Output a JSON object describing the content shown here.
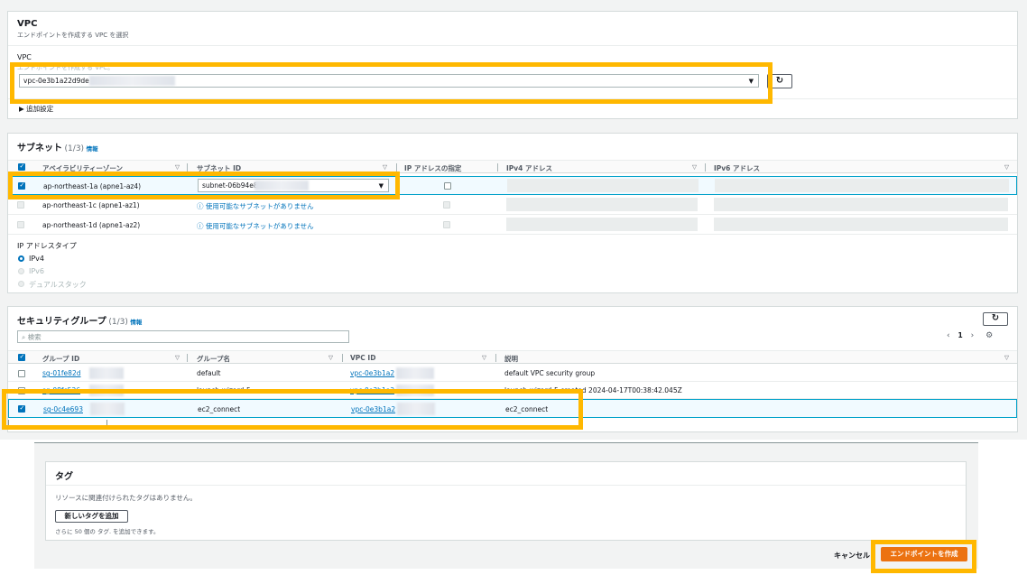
{
  "vpc_panel": {
    "title": "VPC",
    "subtitle": "エンドポイントを作成する VPC を選択",
    "field_label": "VPC",
    "field_hint": "エンドポイントを作成する VPC。",
    "selected_vpc": "vpc-0e3b1a22d9de",
    "advanced": "追加設定"
  },
  "subnet_panel": {
    "title": "サブネット",
    "count": "(1/3)",
    "info": "情報",
    "columns": [
      "アベイラビリティーゾーン",
      "サブネット ID",
      "IP アドレスの指定",
      "IPv4 アドレス",
      "IPv6 アドレス"
    ],
    "rows": [
      {
        "az": "ap-northeast-1a (apne1-az4)",
        "subnet": "subnet-06b94e8",
        "selected": true
      },
      {
        "az": "ap-northeast-1c (apne1-az1)",
        "subnet": "使用可能なサブネットがありません",
        "selected": false
      },
      {
        "az": "ap-northeast-1d (apne1-az2)",
        "subnet": "使用可能なサブネットがありません",
        "selected": false
      }
    ],
    "ip_type_label": "IP アドレスタイプ",
    "ip_types": [
      "IPv4",
      "IPv6",
      "デュアルスタック"
    ]
  },
  "sg_panel": {
    "title": "セキュリティグループ",
    "count": "(1/3)",
    "info": "情報",
    "search_placeholder": "検索",
    "page": "1",
    "columns": [
      "グループ ID",
      "グループ名",
      "VPC ID",
      "説明"
    ],
    "rows": [
      {
        "id": "sg-01fe82d",
        "name": "default",
        "vpc": "vpc-0e3b1a2",
        "desc": "default VPC security group",
        "selected": false
      },
      {
        "id": "sg-08fc526",
        "name": "launch-wizard-5",
        "vpc": "vpc-0e3b1a2",
        "desc": "launch-wizard-5 created 2024-04-17T00:38:42.045Z",
        "selected": false
      },
      {
        "id": "sg-0c4e693",
        "name": "ec2_connect",
        "vpc": "vpc-0e3b1a2",
        "desc": "ec2_connect",
        "selected": true
      }
    ]
  },
  "tags_panel": {
    "title": "タグ",
    "empty": "リソースに関連付けられたタグはありません。",
    "add_button": "新しいタグを追加",
    "limit": "さらに 50 個の タグ. を追加できます。"
  },
  "footer": {
    "cancel": "キャンセル",
    "create": "エンドポイントを作成"
  },
  "colors": {
    "highlight": "#ffb800",
    "primary": "#ec7211",
    "link": "#0073bb"
  }
}
